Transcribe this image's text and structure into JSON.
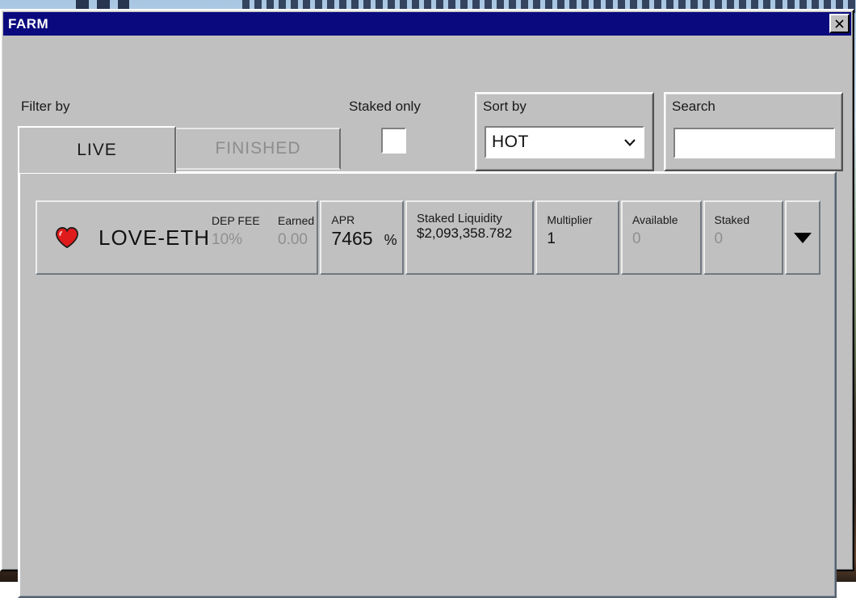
{
  "window": {
    "title": "FARM",
    "close_label": "✕"
  },
  "toolbar": {
    "filter_label": "Filter by",
    "tabs": [
      {
        "label": "LIVE",
        "state": "active"
      },
      {
        "label": "FINISHED",
        "state": "inactive"
      }
    ],
    "staked_only": {
      "label": "Staked only",
      "checked": false
    },
    "sort_by": {
      "label": "Sort by",
      "value": "HOT",
      "chevron": "⌄",
      "icon": "chevron-down-icon"
    },
    "search": {
      "label": "Search",
      "value": "",
      "placeholder": ""
    }
  },
  "farm_list": {
    "rows": [
      {
        "favorite_icon": "heart-icon",
        "favorited": true,
        "pair": "LOVE-ETH",
        "dep_fee": {
          "label": "DEP FEE",
          "value": "10%"
        },
        "earned": {
          "label": "Earned",
          "value": "0.00"
        },
        "apr": {
          "label": "APR",
          "value": "7465",
          "unit": "%"
        },
        "staked_liquidity": {
          "label": "Staked Liquidity",
          "value": "$2,093,358.782"
        },
        "multiplier": {
          "label": "Multiplier",
          "value": "1"
        },
        "available": {
          "label": "Available",
          "value": "0"
        },
        "staked": {
          "label": "Staked",
          "value": "0"
        },
        "expand_icon": "chevron-down-icon"
      }
    ]
  },
  "colors": {
    "titlebar": "#0a0a7e",
    "face": "#c0c0c0",
    "accent_heart": "#e01b1b",
    "text": "#111111",
    "dim_text": "#8f8f8f"
  }
}
